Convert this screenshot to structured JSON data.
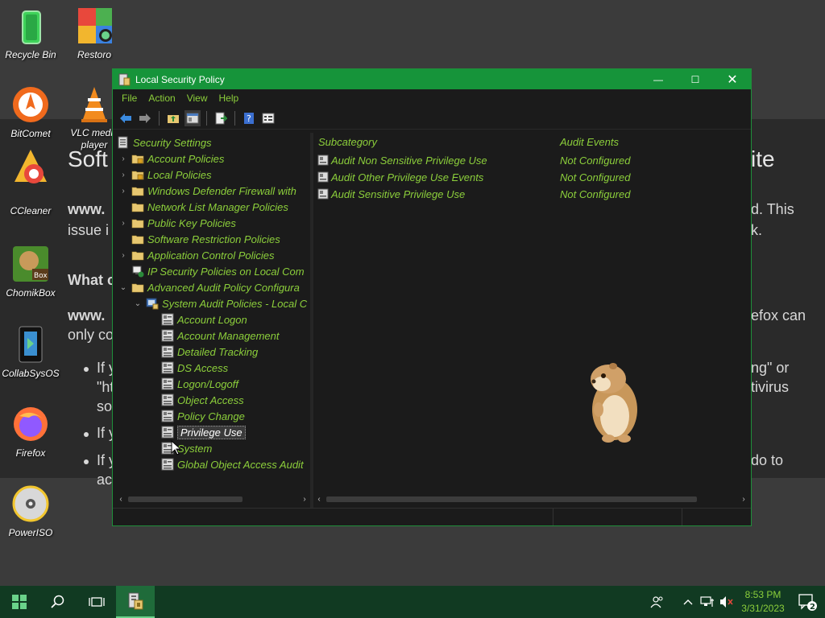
{
  "desktop": {
    "icons": [
      {
        "label": "Recycle Bin"
      },
      {
        "label": "Restoro"
      },
      {
        "label": "BitComet"
      },
      {
        "label": "VLC media player"
      },
      {
        "label": "CCleaner"
      },
      {
        "label": "ChomikBox"
      },
      {
        "label": "CollabSysOS"
      },
      {
        "label": "Firefox"
      },
      {
        "label": "PowerISO"
      }
    ],
    "background_page": {
      "title_left": "Soft",
      "title_right": "ite",
      "line1_left": "www.",
      "line1_right": "d. This",
      "line2_left": "issue i",
      "line2_right": "k.",
      "heading_left": "What c",
      "line3_left": "www.",
      "line3_right": "efox can",
      "line4_left": "only co",
      "bullet1_left": "If y",
      "bullet1_right": "ng\" or",
      "bullet1b_left": "\"ht",
      "bullet1b_right": "tivirus",
      "bullet1c_left": "so",
      "bullet2_left": "If y",
      "bullet3_left": "If y",
      "bullet3_right": "do to",
      "bullet3b_left": "ac"
    }
  },
  "window": {
    "title": "Local Security Policy",
    "menu": [
      "File",
      "Action",
      "View",
      "Help"
    ],
    "controls": {
      "minimize": "—",
      "maximize": "☐",
      "close": "✕"
    }
  },
  "tree": [
    {
      "label": "Security Settings",
      "level": 0,
      "expander": "",
      "icon": "security-settings-icon"
    },
    {
      "label": "Account Policies",
      "level": 1,
      "expander": "›",
      "icon": "folder-lock-icon"
    },
    {
      "label": "Local Policies",
      "level": 1,
      "expander": "›",
      "icon": "folder-lock-icon"
    },
    {
      "label": "Windows Defender Firewall with",
      "level": 1,
      "expander": "›",
      "icon": "folder-icon"
    },
    {
      "label": "Network List Manager Policies",
      "level": 1,
      "expander": "",
      "icon": "folder-icon"
    },
    {
      "label": "Public Key Policies",
      "level": 1,
      "expander": "›",
      "icon": "folder-icon"
    },
    {
      "label": "Software Restriction Policies",
      "level": 1,
      "expander": "",
      "icon": "folder-icon"
    },
    {
      "label": "Application Control Policies",
      "level": 1,
      "expander": "›",
      "icon": "folder-icon"
    },
    {
      "label": "IP Security Policies on Local Com",
      "level": 1,
      "expander": "",
      "icon": "ip-security-icon"
    },
    {
      "label": "Advanced Audit Policy Configura",
      "level": 1,
      "expander": "⌄",
      "icon": "folder-icon"
    },
    {
      "label": "System Audit Policies - Local C",
      "level": 2,
      "expander": "⌄",
      "icon": "audit-policies-icon"
    },
    {
      "label": "Account Logon",
      "level": 3,
      "expander": "",
      "icon": "policy-icon"
    },
    {
      "label": "Account Management",
      "level": 3,
      "expander": "",
      "icon": "policy-icon"
    },
    {
      "label": "Detailed Tracking",
      "level": 3,
      "expander": "",
      "icon": "policy-icon"
    },
    {
      "label": "DS Access",
      "level": 3,
      "expander": "",
      "icon": "policy-icon"
    },
    {
      "label": "Logon/Logoff",
      "level": 3,
      "expander": "",
      "icon": "policy-icon"
    },
    {
      "label": "Object Access",
      "level": 3,
      "expander": "",
      "icon": "policy-icon"
    },
    {
      "label": "Policy Change",
      "level": 3,
      "expander": "",
      "icon": "policy-icon"
    },
    {
      "label": "Privilege Use",
      "level": 3,
      "expander": "",
      "icon": "policy-icon",
      "selected": true
    },
    {
      "label": "System",
      "level": 3,
      "expander": "",
      "icon": "policy-icon"
    },
    {
      "label": "Global Object Access Audit",
      "level": 3,
      "expander": "",
      "icon": "policy-icon"
    }
  ],
  "list": {
    "columns": [
      "Subcategory",
      "Audit Events"
    ],
    "rows": [
      {
        "subcategory": "Audit Non Sensitive Privilege Use",
        "audit_events": "Not Configured"
      },
      {
        "subcategory": "Audit Other Privilege Use Events",
        "audit_events": "Not Configured"
      },
      {
        "subcategory": "Audit Sensitive Privilege Use",
        "audit_events": "Not Configured"
      }
    ]
  },
  "taskbar": {
    "clock_time": "8:53 PM",
    "clock_date": "3/31/2023",
    "notification_count": "2"
  },
  "colors": {
    "accent": "#16943a",
    "text_green": "#8ccf3b",
    "taskbar": "#113a22"
  }
}
